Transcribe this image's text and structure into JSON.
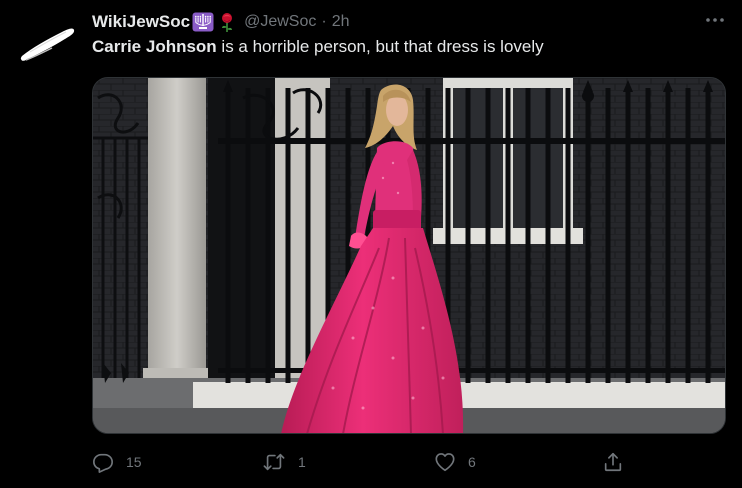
{
  "tweet": {
    "display_name": "WikiJewSoc",
    "badges": [
      "menorah-emoji",
      "rose-emoji"
    ],
    "handle": "@JewSoc",
    "separator": "·",
    "time": "2h",
    "text_bold": "Carrie Johnson",
    "text_rest": " is a horrible person, but that dress is lovely"
  },
  "actions": {
    "reply_count": "15",
    "retweet_count": "1",
    "like_count": "6"
  },
  "icons": {
    "more": "more-horizontal-icon",
    "reply": "reply-icon",
    "retweet": "retweet-icon",
    "like": "heart-icon",
    "share": "share-icon"
  },
  "colors": {
    "background": "#000000",
    "text_primary": "#e7e9ea",
    "text_secondary": "#71767b",
    "dress_pink": "#e8286f"
  }
}
